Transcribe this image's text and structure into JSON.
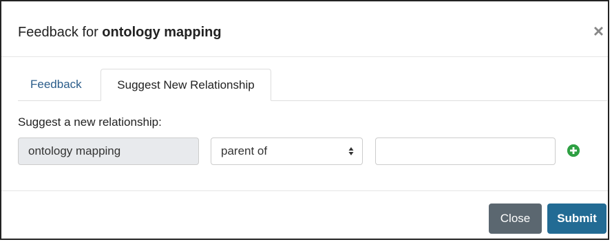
{
  "header": {
    "title_prefix": "Feedback for ",
    "title_subject": "ontology mapping",
    "close_glyph": "×"
  },
  "tabs": [
    {
      "label": "Feedback",
      "active": false
    },
    {
      "label": "Suggest New Relationship",
      "active": true
    }
  ],
  "form": {
    "label": "Suggest a new relationship:",
    "source_value": "ontology mapping",
    "relation_selected": "parent of",
    "target_value": "",
    "add_icon": "plus-circle-icon"
  },
  "footer": {
    "close_label": "Close",
    "submit_label": "Submit"
  },
  "colors": {
    "link_tab": "#2a5c8a",
    "close_button": "#5b6770",
    "submit_button": "#226b94",
    "add_icon": "#2ea043",
    "readonly_field": "#e8eaed"
  }
}
